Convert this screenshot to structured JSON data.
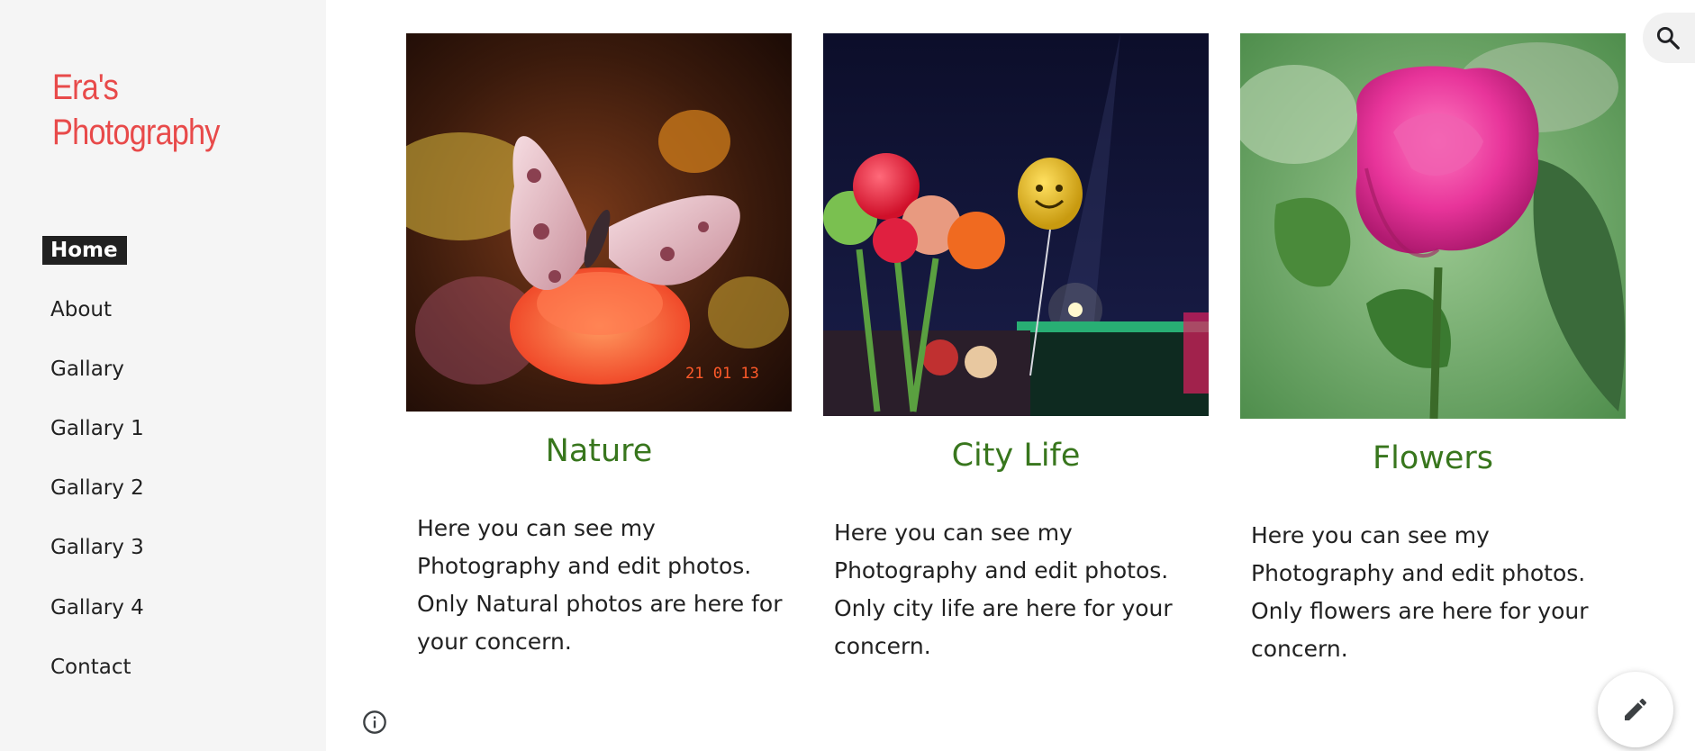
{
  "site": {
    "title_line1": "Era's",
    "title_line2": "Photography"
  },
  "nav": {
    "items": [
      {
        "label": "Home",
        "active": true
      },
      {
        "label": "About"
      },
      {
        "label": "Gallary"
      },
      {
        "label": "Gallary 1"
      },
      {
        "label": "Gallary 2"
      },
      {
        "label": "Gallary 3"
      },
      {
        "label": "Gallary 4"
      },
      {
        "label": "Contact"
      }
    ]
  },
  "cards": [
    {
      "title": "Nature",
      "text": "Here you can see my Photography and edit photos. Only Natural photos are here for your concern.",
      "photo_subject": "pink-butterfly-on-orange-marigold",
      "photo_stamp": "21 01 13"
    },
    {
      "title": "City Life",
      "text": "Here you can see my Photography and edit photos. Only city life are here for your concern.",
      "photo_subject": "balloons-at-night-fair"
    },
    {
      "title": "Flowers",
      "text": "Here you can see my Photography and edit photos. Only flowers are here for your concern.",
      "photo_subject": "pink-rose-with-green-leaves"
    }
  ],
  "icons": {
    "search": "search-icon",
    "info": "info-icon",
    "edit": "pencil-icon"
  },
  "colors": {
    "title_accent": "#e84a4a",
    "card_title": "#38761d",
    "sidebar_bg": "#f5f5f5",
    "active_nav_bg": "#212121"
  }
}
